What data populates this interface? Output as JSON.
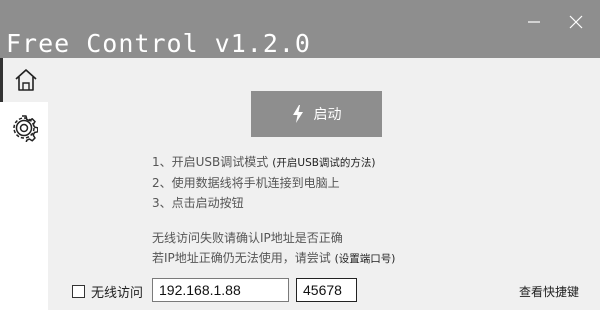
{
  "window": {
    "title": "Free Control v1.2.0",
    "minimize_glyph": "—",
    "close_glyph": "✕"
  },
  "sidebar": {
    "items": [
      {
        "icon": "home-icon",
        "active": true
      },
      {
        "icon": "gear-icon",
        "active": false
      }
    ]
  },
  "main": {
    "start_button": {
      "icon": "bolt-icon",
      "label": "启动"
    },
    "steps": [
      {
        "text": "1、开启USB调试模式",
        "link": "(开启USB调试的方法)"
      },
      {
        "text": "2、使用数据线将手机连接到电脑上"
      },
      {
        "text": "3、点击启动按钮"
      }
    ],
    "wireless_help": {
      "line1": "无线访问失败请确认IP地址是否正确",
      "line2": "若IP地址正确仍无法使用，请尝试",
      "link": "(设置端口号)"
    }
  },
  "footer": {
    "wireless_checkbox": {
      "label": "无线访问",
      "checked": false
    },
    "ip_value": "192.168.1.88",
    "port_value": "45678",
    "shortcut_link": "查看快捷键"
  },
  "colors": {
    "titlebar": "#8e8e8e",
    "button": "#8e8e8e",
    "background": "#f0f0f0"
  }
}
